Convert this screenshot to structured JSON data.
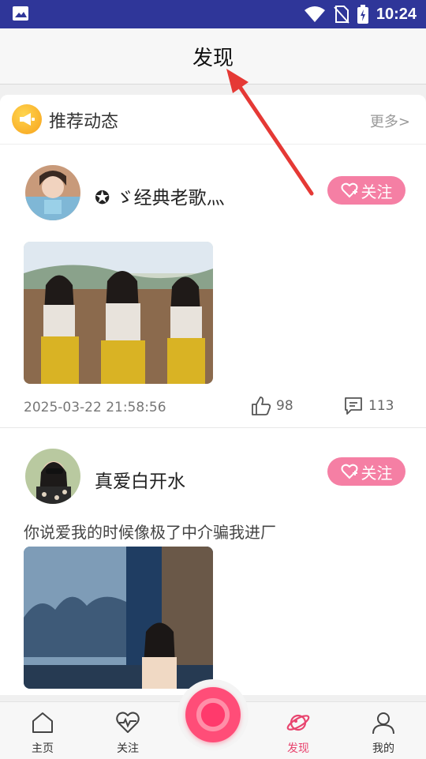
{
  "status_bar": {
    "time": "10:24",
    "icons": [
      "gallery-icon",
      "wifi-icon",
      "no-sim-icon",
      "battery-charging-icon"
    ]
  },
  "header": {
    "title": "发现"
  },
  "section": {
    "title": "推荐动态",
    "more": "更多>",
    "icon": "megaphone-icon"
  },
  "posts": [
    {
      "username": "✪ ゞ经典老歌灬",
      "follow_label": "关注",
      "caption": "",
      "timestamp": "2025-03-22 21:58:56",
      "likes": "98",
      "comments": "113"
    },
    {
      "username": "真爱白开水",
      "follow_label": "关注",
      "caption": "你说爱我的时候像极了中介骗我进厂"
    }
  ],
  "tabbar": {
    "items": [
      {
        "label": "主页",
        "icon": "home-icon"
      },
      {
        "label": "关注",
        "icon": "heart-pulse-icon"
      },
      {
        "label": "发现",
        "icon": "planet-icon",
        "active": true
      },
      {
        "label": "我的",
        "icon": "person-icon"
      }
    ],
    "center_icon": "camera-record-icon"
  },
  "colors": {
    "status_bar": "#2f3699",
    "accent_pink": "#f57fa4",
    "active_tab": "#e8456f",
    "annotation_arrow": "#e53935"
  }
}
